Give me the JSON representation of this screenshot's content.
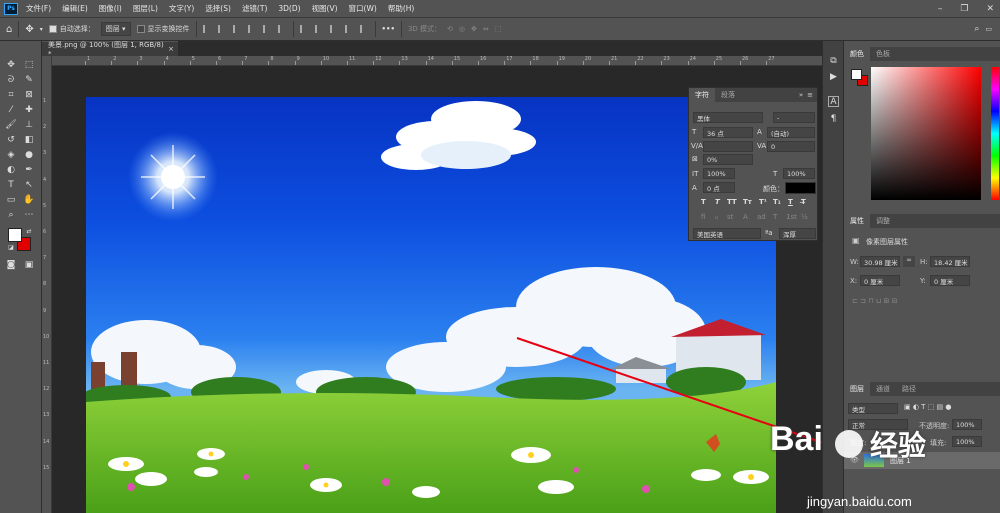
{
  "app": {
    "logo": "Ps"
  },
  "menu": [
    "文件(F)",
    "编辑(E)",
    "图像(I)",
    "图层(L)",
    "文字(Y)",
    "选择(S)",
    "滤镜(T)",
    "3D(D)",
    "视图(V)",
    "窗口(W)",
    "帮助(H)"
  ],
  "window_controls": [
    "–",
    "❐",
    "✕"
  ],
  "options": {
    "auto_select_label": "自动选择：",
    "auto_select_value": "图层",
    "show_transform_label": "显示变换控件",
    "mode_3d_label": "3D 模式：",
    "more": "•••"
  },
  "document": {
    "tab_title": "美景.png @ 100% (图层 1, RGB/8) *",
    "close": "×"
  },
  "ruler_top": [
    "1",
    "2",
    "3",
    "4",
    "5",
    "6",
    "7",
    "8",
    "9",
    "10",
    "11",
    "12",
    "13",
    "14",
    "15",
    "16",
    "17",
    "18",
    "19",
    "20",
    "21",
    "22",
    "23",
    "24",
    "25",
    "26",
    "27"
  ],
  "ruler_left": [
    "1",
    "2",
    "3",
    "4",
    "5",
    "6",
    "7",
    "8",
    "9",
    "10",
    "11",
    "12",
    "13",
    "14",
    "15"
  ],
  "character_panel": {
    "tab1": "字符",
    "tab2": "段落",
    "font_family": "黑体",
    "font_style": "-",
    "font_size": "36 点",
    "leading": "(自动)",
    "kerning": "",
    "tracking": "0",
    "vscale": "0%",
    "hscale_v": "100%",
    "hscale_h": "100%",
    "baseline": "0 点",
    "color_label": "颜色：",
    "styles": [
      "T",
      "T",
      "TT",
      "Tт",
      "T¹",
      "T₁",
      "T",
      "T̶"
    ],
    "opentype": [
      "fi",
      "ℴ",
      "st",
      "A",
      "ad",
      "T",
      "1st",
      "½"
    ],
    "language": "美国英语",
    "aa_label": "ªa",
    "aa_value": "浑厚"
  },
  "color_panel": {
    "tab1": "颜色",
    "tab2": "色板",
    "fg": "#ffffff",
    "bg": "#e00000"
  },
  "properties_panel": {
    "tab1": "属性",
    "tab2": "调整",
    "title": "像素图层属性",
    "w_label": "W:",
    "w_value": "30.98 厘米",
    "h_label": "H:",
    "h_value": "18.42 厘米",
    "x_label": "X:",
    "x_value": "0 厘米",
    "y_label": "Y:",
    "y_value": "0 厘米"
  },
  "layers_panel": {
    "tab1": "图层",
    "tab2": "通道",
    "tab3": "路径",
    "kind": "类型",
    "blend": "正常",
    "opacity_label": "不透明度:",
    "opacity": "100%",
    "lock_label": "锁定:",
    "fill_label": "填充:",
    "fill": "100%",
    "layer_name": "图层 1"
  },
  "watermark": {
    "brand": "Bai",
    "brand2": "经验",
    "url": "jingyan.baidu.com"
  },
  "colors": {
    "accent_red": "#e60012",
    "ui": "#535353"
  }
}
